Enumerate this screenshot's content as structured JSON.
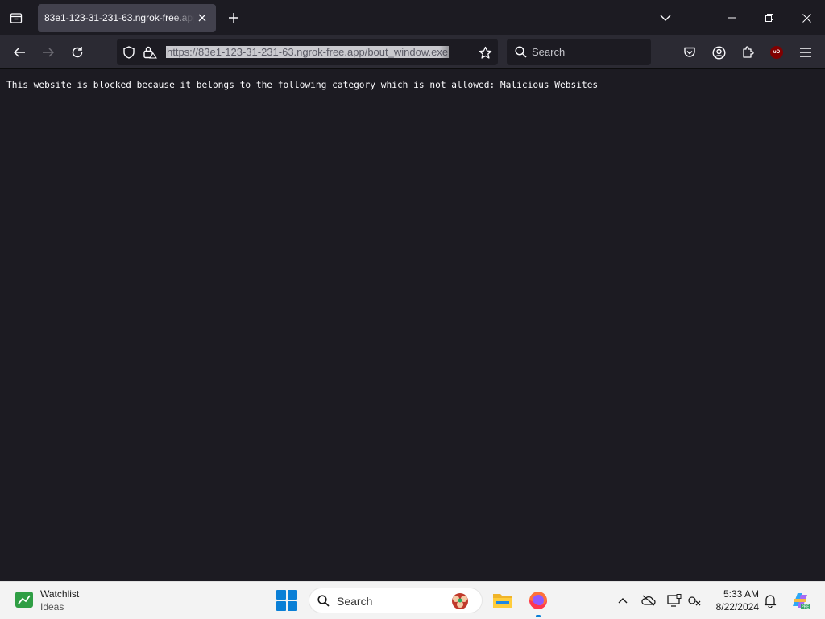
{
  "tabs": [
    {
      "title": "83e1-123-31-231-63.ngrok-free.app"
    }
  ],
  "urlbar": {
    "url": "https://83e1-123-31-231-63.ngrok-free.app/bout_window.exe"
  },
  "searchbar": {
    "placeholder": "Search"
  },
  "page": {
    "message": "This website is blocked because it belongs to the following category which is not allowed: Malicious Websites"
  },
  "taskbar": {
    "widget_title": "Watchlist",
    "widget_subtitle": "Ideas",
    "search_placeholder": "Search",
    "time": "5:33 AM",
    "date": "8/22/2024"
  },
  "colors": {
    "browser_bg": "#1c1b22",
    "toolbar_bg": "#2b2a33",
    "active_tab": "#42414d",
    "taskbar_bg": "#f3f3f3",
    "accent": "#0a7fd6"
  }
}
